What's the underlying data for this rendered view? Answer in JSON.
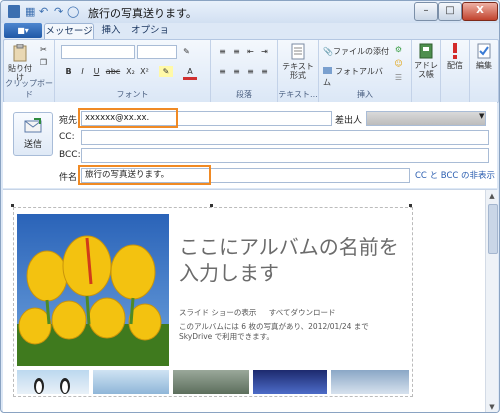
{
  "window": {
    "title": "旅行の写真送ります。",
    "close_glyph": "X",
    "min_glyph": "–",
    "max_glyph": "□"
  },
  "tabs": [
    {
      "label": "メッセージ"
    },
    {
      "label": "挿入"
    },
    {
      "label": "オプション"
    }
  ],
  "ribbon": {
    "paste_label": "貼り付け",
    "clipboard_group": "クリップボード",
    "font_group": "フォント",
    "paragraph_group": "段落",
    "text_group": "テキスト...",
    "insert_group": "挿入",
    "text_format_label": "テキスト形式",
    "attach_file_label": "ファイルの添付",
    "photo_album_label": "フォトアルバム",
    "address_book_label": "アドレス帳",
    "delivery_label": "配信",
    "edit_label": "編集",
    "font_buttons": [
      "B",
      "I",
      "U",
      "abc",
      "X₂",
      "X²"
    ]
  },
  "compose": {
    "send_label": "送信",
    "to_label": "宛先:",
    "to_value": "xxxxxx@xx.xx.",
    "from_label": "差出人",
    "cc_label": "CC:",
    "bcc_label": "BCC:",
    "subject_label": "件名",
    "subject_value": "旅行の写真送ります。",
    "cc_bcc_link": "CC と BCC の非表示"
  },
  "album": {
    "title_line1": "ここにアルバムの名前を",
    "title_line2": "入力します",
    "links": [
      "スライド ショーの表示",
      "すべてダウンロード"
    ],
    "description": "このアルバムには 6 枚の写真があり、2012/01/24 まで SkyDrive で利用できます。"
  },
  "colors": {
    "highlight": "#f08a24",
    "link": "#2a5db0",
    "accent": "#2a62ad"
  }
}
